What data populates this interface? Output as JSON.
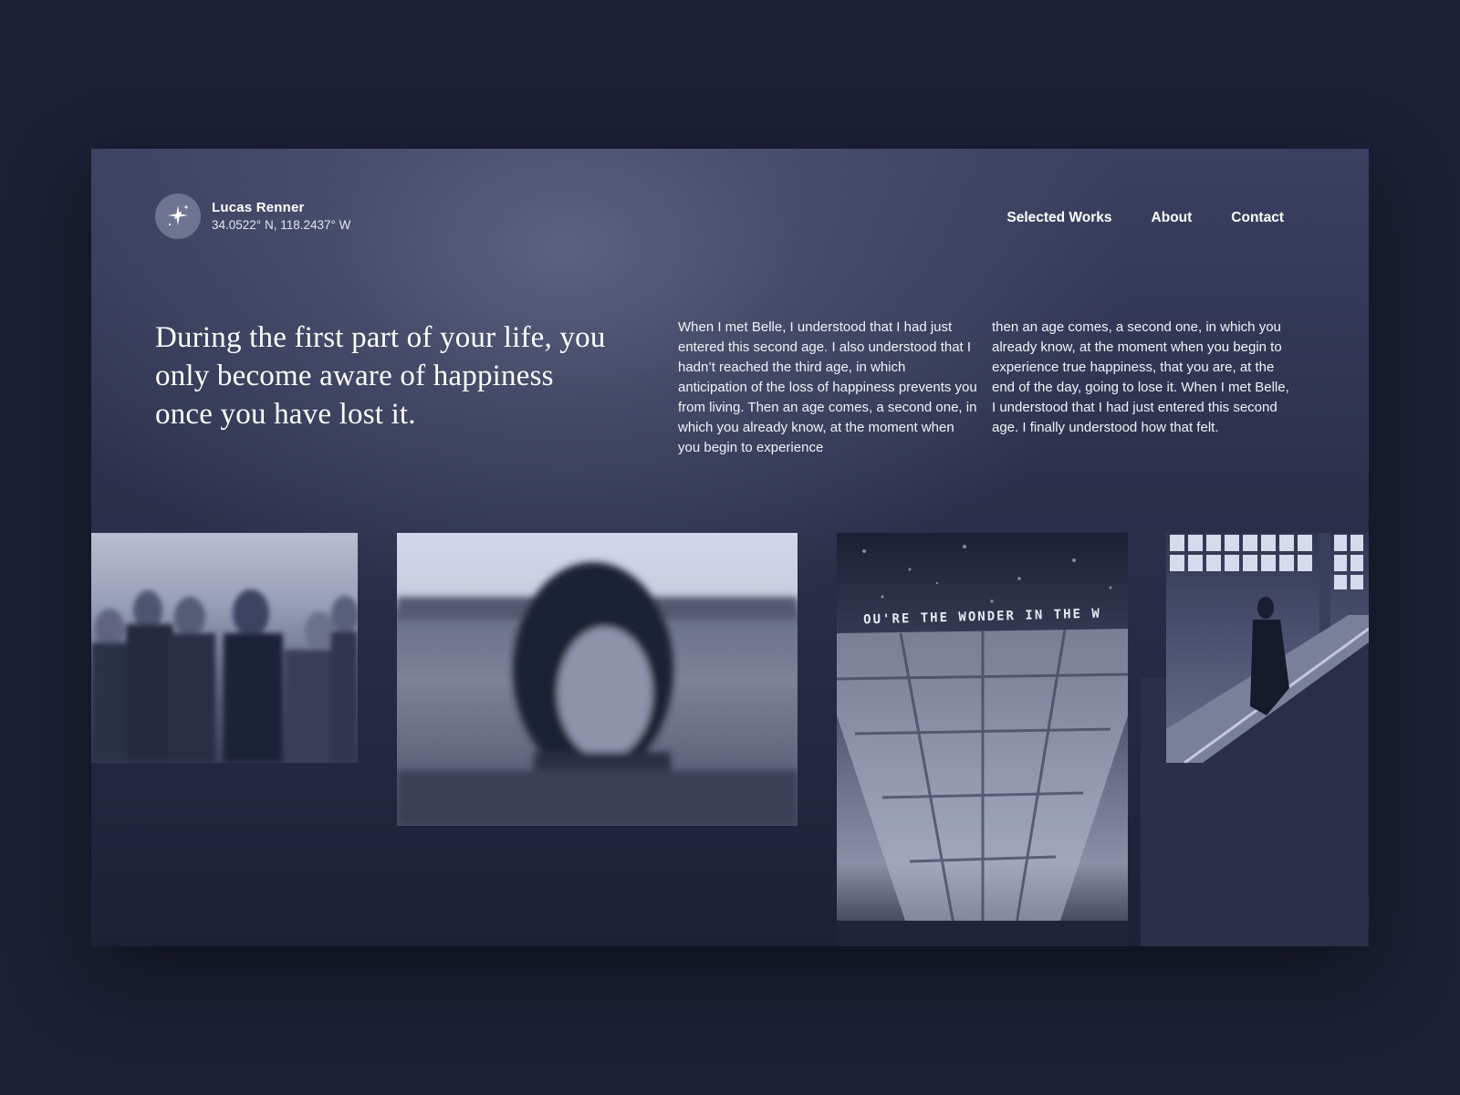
{
  "brand": {
    "name": "Lucas Renner",
    "coordinates": "34.0522° N, 118.2437° W",
    "logo_icon": "sparkle-star-icon"
  },
  "nav": {
    "items": [
      "Selected Works",
      "About",
      "Contact"
    ]
  },
  "hero": {
    "headline": "During the first part of your life, you only become aware of happiness once you have lost it.",
    "body_col1": "When I met Belle, I understood that I had just entered this second age. I also understood that I hadn’t reached the third age, in which anticipation of the loss of happiness prevents you from living. Then an age comes, a second one, in which you already know, at the moment when you begin to experience",
    "body_col2": "then an age comes, a second one, in which you already know, at the moment when you begin to experience true happiness, that you are, at the end of the day, going to lose it. When I met Belle, I understood that I had just entered this second age. I finally understood how that felt."
  },
  "gallery": {
    "photo3_banner": "OU'RE THE WONDER IN THE W"
  },
  "colors": {
    "page_background": "#1c2035",
    "text": "#ffffff"
  }
}
